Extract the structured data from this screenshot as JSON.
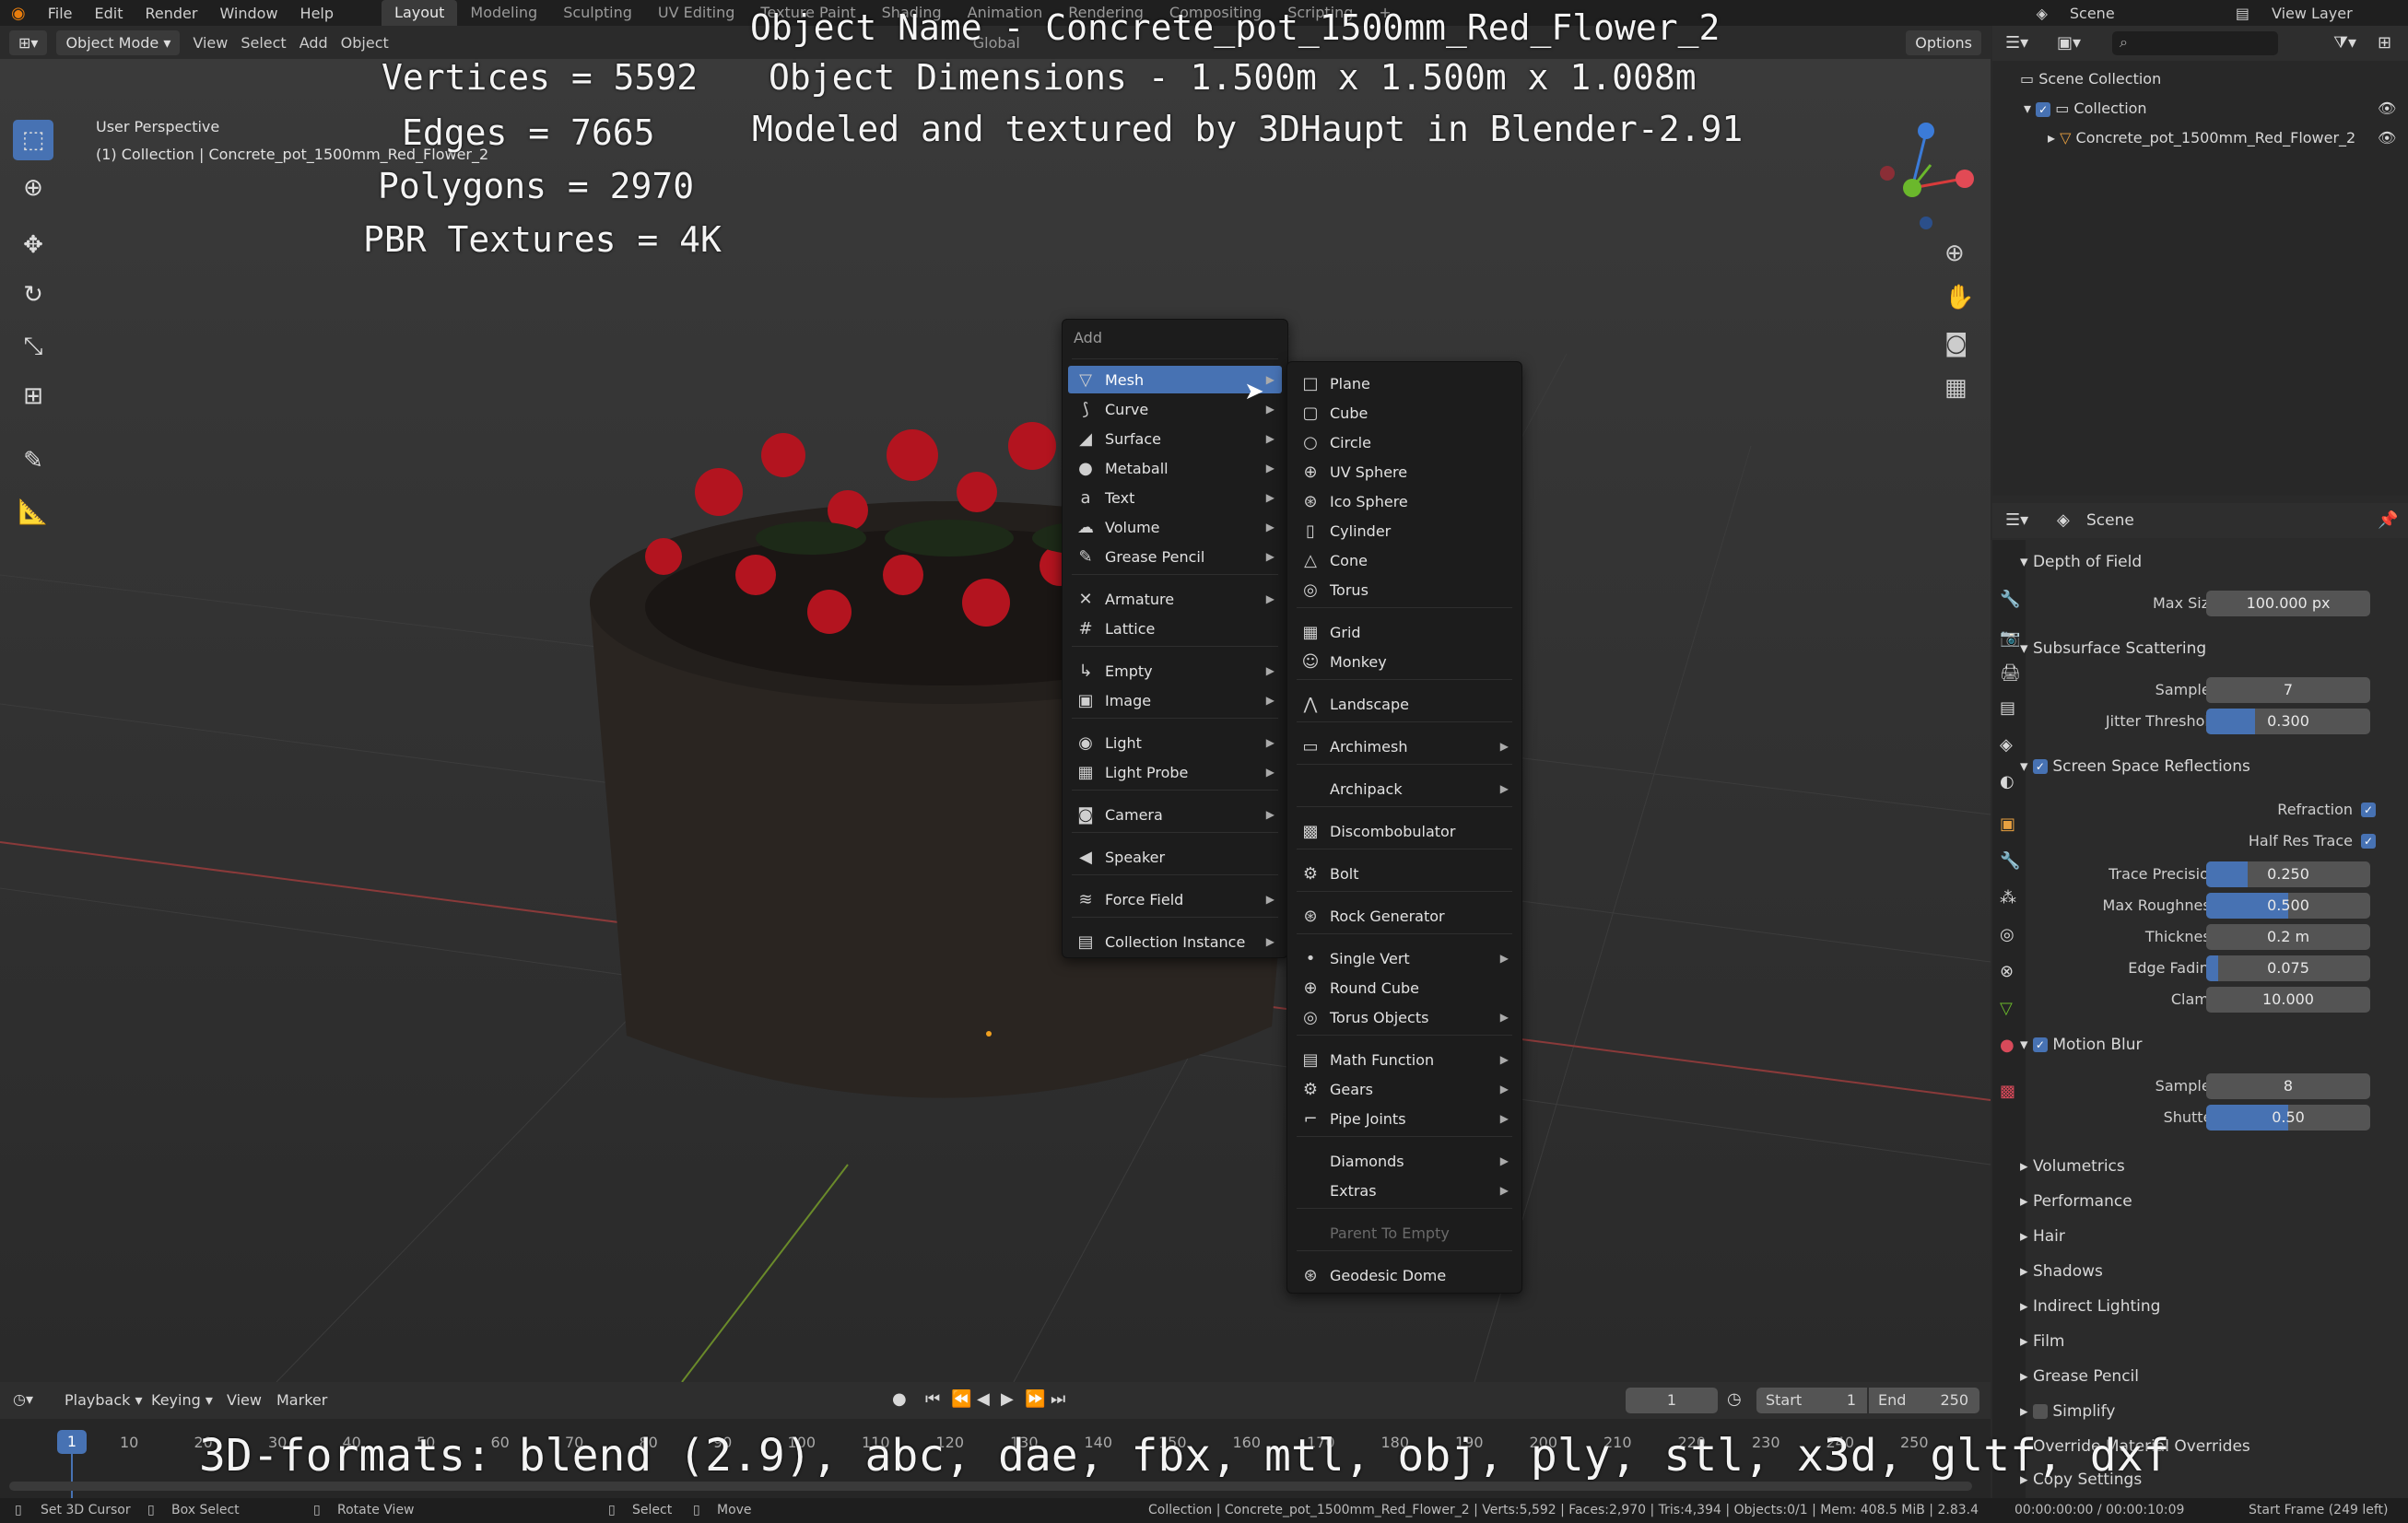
{
  "topbar": {
    "menus": [
      "File",
      "Edit",
      "Render",
      "Window",
      "Help"
    ],
    "workspaces": [
      "Layout",
      "Modeling",
      "Sculpting",
      "UV Editing",
      "Texture Paint",
      "Shading",
      "Animation",
      "Rendering",
      "Compositing",
      "Scripting"
    ],
    "active_workspace": "Layout",
    "scene": "Scene",
    "view_layer": "View Layer"
  },
  "viewport_header": {
    "mode": "Object Mode",
    "menus": [
      "View",
      "Select",
      "Add",
      "Object"
    ],
    "orientation": "Global",
    "options": "Options"
  },
  "viewport": {
    "perspective": "User Perspective",
    "collection_info": "(1) Collection | Concrete_pot_1500mm_Red_Flower_2"
  },
  "overlay": {
    "object_name": "Object Name - Concrete_pot_1500mm_Red_Flower_2",
    "object_dimensions": "Object Dimensions -  1.500m x 1.500m x 1.008m",
    "credits": "Modeled and textured by 3DHaupt in Blender-2.91",
    "vertices": "Vertices = 5592",
    "edges": "Edges = 7665",
    "polygons": "Polygons = 2970",
    "textures": "PBR Textures = 4K",
    "formats": "3D-formats: blend (2.9), abc, dae, fbx, mtl, obj, ply, stl, x3d, gltf, dxf"
  },
  "add_menu": {
    "title": "Add",
    "items": [
      {
        "label": "Mesh",
        "icon": "mesh-icon",
        "glyph": "▽",
        "sub": true
      },
      {
        "label": "Curve",
        "icon": "curve-icon",
        "glyph": "⟆",
        "sub": true
      },
      {
        "label": "Surface",
        "icon": "surface-icon",
        "glyph": "◢",
        "sub": true
      },
      {
        "label": "Metaball",
        "icon": "metaball-icon",
        "glyph": "●",
        "sub": true
      },
      {
        "label": "Text",
        "icon": "text-icon",
        "glyph": "a",
        "sub": true
      },
      {
        "label": "Volume",
        "icon": "volume-icon",
        "glyph": "☁",
        "sub": true
      },
      {
        "label": "Grease Pencil",
        "icon": "grease-pencil-icon",
        "glyph": "✎",
        "sub": true
      },
      {
        "label": "Armature",
        "icon": "armature-icon",
        "glyph": "✕",
        "sub": true
      },
      {
        "label": "Lattice",
        "icon": "lattice-icon",
        "glyph": "#",
        "sub": false
      },
      {
        "label": "Empty",
        "icon": "empty-icon",
        "glyph": "↳",
        "sub": true
      },
      {
        "label": "Image",
        "icon": "image-icon",
        "glyph": "▣",
        "sub": true
      },
      {
        "label": "Light",
        "icon": "light-icon",
        "glyph": "◉",
        "sub": true
      },
      {
        "label": "Light Probe",
        "icon": "light-probe-icon",
        "glyph": "▦",
        "sub": true
      },
      {
        "label": "Camera",
        "icon": "camera-icon",
        "glyph": "◙",
        "sub": true
      },
      {
        "label": "Speaker",
        "icon": "speaker-icon",
        "glyph": "◀",
        "sub": false
      },
      {
        "label": "Force Field",
        "icon": "force-field-icon",
        "glyph": "≋",
        "sub": true
      },
      {
        "label": "Collection Instance",
        "icon": "collection-instance-icon",
        "glyph": "▤",
        "sub": true
      }
    ]
  },
  "mesh_menu": {
    "items": [
      {
        "label": "Plane",
        "icon": "plane-icon",
        "glyph": "□",
        "sub": false
      },
      {
        "label": "Cube",
        "icon": "cube-icon",
        "glyph": "▢",
        "sub": false
      },
      {
        "label": "Circle",
        "icon": "circle-icon",
        "glyph": "○",
        "sub": false
      },
      {
        "label": "UV Sphere",
        "icon": "uv-sphere-icon",
        "glyph": "⊕",
        "sub": false
      },
      {
        "label": "Ico Sphere",
        "icon": "ico-sphere-icon",
        "glyph": "⊛",
        "sub": false
      },
      {
        "label": "Cylinder",
        "icon": "cylinder-icon",
        "glyph": "▯",
        "sub": false
      },
      {
        "label": "Cone",
        "icon": "cone-icon",
        "glyph": "△",
        "sub": false
      },
      {
        "label": "Torus",
        "icon": "torus-icon",
        "glyph": "◎",
        "sub": false
      },
      {
        "label": "Grid",
        "icon": "grid-icon",
        "glyph": "▦",
        "sub": false
      },
      {
        "label": "Monkey",
        "icon": "monkey-icon",
        "glyph": "☺",
        "sub": false
      },
      {
        "label": "Landscape",
        "icon": "landscape-icon",
        "glyph": "⋀",
        "sub": false
      },
      {
        "label": "Archimesh",
        "icon": "archimesh-icon",
        "glyph": "▭",
        "sub": true
      },
      {
        "label": "Archipack",
        "icon": "archipack-icon",
        "glyph": "",
        "sub": true
      },
      {
        "label": "Discombobulator",
        "icon": "discombobulator-icon",
        "glyph": "▩",
        "sub": false
      },
      {
        "label": "Bolt",
        "icon": "bolt-icon",
        "glyph": "⚙",
        "sub": false
      },
      {
        "label": "Rock Generator",
        "icon": "rock-generator-icon",
        "glyph": "⊛",
        "sub": false
      },
      {
        "label": "Single Vert",
        "icon": "single-vert-icon",
        "glyph": "•",
        "sub": true
      },
      {
        "label": "Round Cube",
        "icon": "round-cube-icon",
        "glyph": "⊕",
        "sub": false
      },
      {
        "label": "Torus Objects",
        "icon": "torus-objects-icon",
        "glyph": "◎",
        "sub": true
      },
      {
        "label": "Math Function",
        "icon": "math-function-icon",
        "glyph": "▤",
        "sub": true
      },
      {
        "label": "Gears",
        "icon": "gears-icon",
        "glyph": "⚙",
        "sub": true
      },
      {
        "label": "Pipe Joints",
        "icon": "pipe-joints-icon",
        "glyph": "⌐",
        "sub": true
      },
      {
        "label": "Diamonds",
        "icon": "diamonds-icon",
        "glyph": "",
        "sub": true
      },
      {
        "label": "Extras",
        "icon": "extras-icon",
        "glyph": "",
        "sub": true
      },
      {
        "label": "Parent To Empty",
        "icon": "parent-to-empty-icon",
        "glyph": "",
        "sub": false,
        "disabled": true
      },
      {
        "label": "Geodesic Dome",
        "icon": "geodesic-dome-icon",
        "glyph": "⊛",
        "sub": false
      }
    ]
  },
  "outliner": {
    "root": "Scene Collection",
    "collection": "Collection",
    "object": "Concrete_pot_1500mm_Red_Flower_2"
  },
  "properties": {
    "context": "Scene",
    "depth_of_field": {
      "title": "Depth of Field",
      "max_size_label": "Max Size",
      "max_size": "100.000 px"
    },
    "sss": {
      "title": "Subsurface Scattering",
      "samples_label": "Samples",
      "samples": "7",
      "jitter_label": "Jitter Threshold",
      "jitter": "0.300",
      "jitter_fill": 0.3
    },
    "ssr": {
      "title": "Screen Space Reflections",
      "refraction_label": "Refraction",
      "half_res_label": "Half Res Trace",
      "trace_label": "Trace Precision",
      "trace": "0.250",
      "trace_fill": 0.25,
      "roughness_label": "Max Roughness",
      "roughness": "0.500",
      "roughness_fill": 0.5,
      "thickness_label": "Thickness",
      "thickness": "0.2 m",
      "fading_label": "Edge Fading",
      "fading": "0.075",
      "fading_fill": 0.075,
      "clamp_label": "Clamp",
      "clamp": "10.000"
    },
    "motion_blur": {
      "title": "Motion Blur",
      "samples_label": "Samples",
      "samples": "8",
      "shutter_label": "Shutter",
      "shutter": "0.50",
      "shutter_fill": 0.5
    },
    "collapsed": [
      "Volumetrics",
      "Performance",
      "Hair",
      "Shadows",
      "Indirect Lighting",
      "Film",
      "Grease Pencil",
      "Simplify",
      "Override Material Overrides",
      "Copy Settings"
    ]
  },
  "timeline": {
    "menus": [
      "Playback",
      "Keying",
      "View",
      "Marker"
    ],
    "current_frame": "1",
    "start_label": "Start",
    "start": "1",
    "end_label": "End",
    "end": "250",
    "ticks": [
      "1",
      "10",
      "20",
      "30",
      "40",
      "50",
      "60",
      "70",
      "80",
      "90",
      "100",
      "110",
      "120",
      "130",
      "140",
      "150",
      "160",
      "170",
      "180",
      "190",
      "200",
      "210",
      "220",
      "230",
      "240",
      "250"
    ]
  },
  "statusbar": {
    "hints": [
      "Set 3D Cursor",
      "Box Select",
      "Rotate View",
      "Select",
      "Move"
    ],
    "stats": "Collection | Concrete_pot_1500mm_Red_Flower_2 | Verts:5,592 | Faces:2,970 | Tris:4,394 | Objects:0/1 | Mem: 408.5 MiB | 2.83.4",
    "time": "00:00:00:00 / 00:00:10:09",
    "frame_info": "Start Frame (249 left)"
  },
  "colors": {
    "accent": "#4772b3",
    "menu_bg": "#1c1c1c",
    "flower_red": "#b3141f",
    "pot": "#2a2521"
  }
}
